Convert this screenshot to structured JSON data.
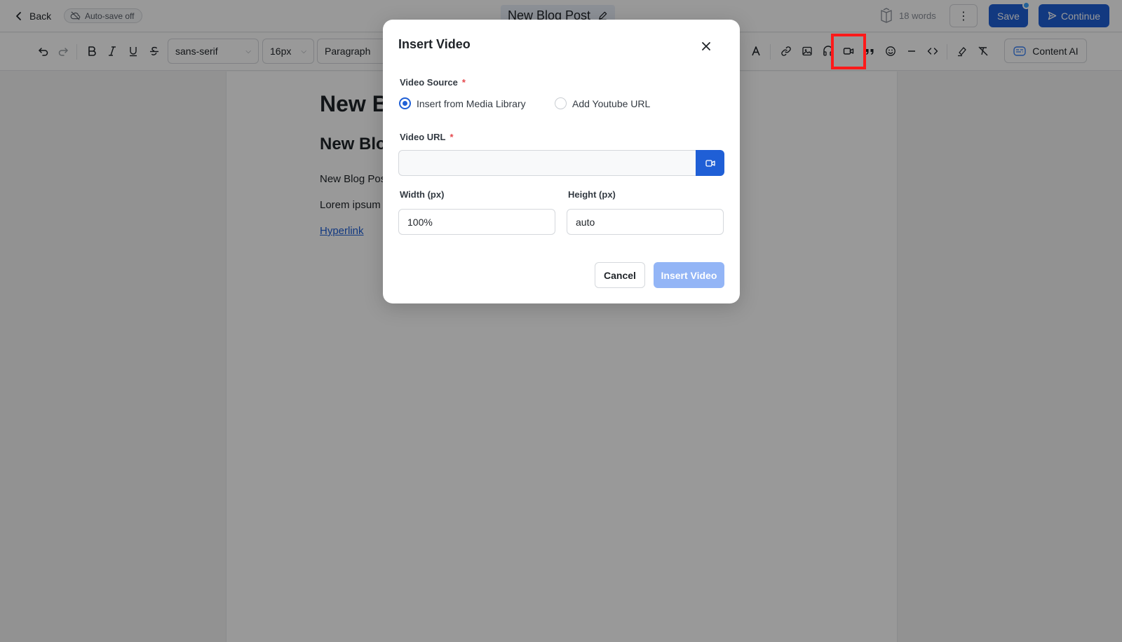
{
  "header": {
    "back_label": "Back",
    "autosave_label": "Auto-save off",
    "doc_title": "New Blog Post",
    "word_count": "18 words",
    "more_label": "⋮",
    "save_label": "Save",
    "continue_label": "Continue"
  },
  "toolbar": {
    "font_family": "sans-serif",
    "font_size": "16px",
    "block_type": "Paragraph",
    "content_ai_label": "Content AI"
  },
  "document": {
    "h1": "New B",
    "h2": "New Blo",
    "p1": "New Blog Pos",
    "p2": "Lorem ipsum",
    "link": "Hyperlink"
  },
  "modal": {
    "title": "Insert Video",
    "source_label": "Video Source",
    "source_required": "*",
    "source_options": [
      {
        "label": "Insert from Media Library",
        "checked": true
      },
      {
        "label": "Add Youtube URL",
        "checked": false
      }
    ],
    "url_label": "Video URL",
    "url_required": "*",
    "url_value": "",
    "width_label": "Width (px)",
    "width_value": "100%",
    "height_label": "Height (px)",
    "height_value": "auto",
    "cancel_label": "Cancel",
    "insert_label": "Insert Video"
  },
  "colors": {
    "primary": "#1f5fd6",
    "highlight": "#ff1a1a",
    "disabled_primary": "#93b5f6"
  }
}
